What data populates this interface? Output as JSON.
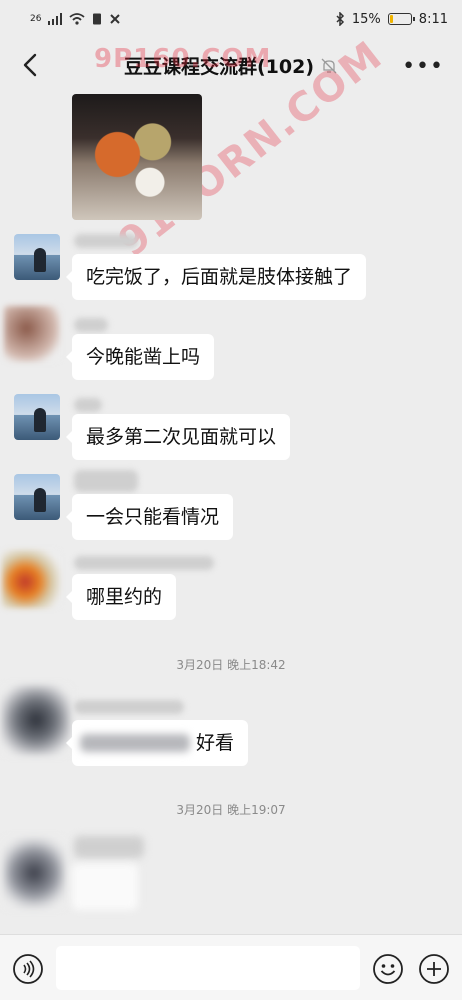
{
  "status_bar": {
    "network": "26",
    "battery_percent": "15%",
    "battery_level": 0.15,
    "time": "8:11"
  },
  "header": {
    "title": "豆豆课程交流群(102)",
    "back_icon": "chevron-left-icon",
    "mute_icon": "bell-off-icon",
    "more_icon": "more-horizontal-icon"
  },
  "watermarks": [
    "9P160.COM",
    "91PORN.COM"
  ],
  "messages": [
    {
      "text": "吃完饭了，后面就是肢体接触了"
    },
    {
      "text": "今晚能凿上吗"
    },
    {
      "text": "最多第二次见面就可以"
    },
    {
      "text": "一会只能看情况"
    },
    {
      "text": "哪里约的"
    },
    {
      "text": "好看"
    }
  ],
  "time_separators": [
    "3月20日 晚上18:42",
    "3月20日 晚上19:07"
  ],
  "input_bar": {
    "placeholder": "",
    "voice_icon": "voice-icon",
    "emoji_icon": "emoji-icon",
    "plus_icon": "plus-circle-icon"
  }
}
